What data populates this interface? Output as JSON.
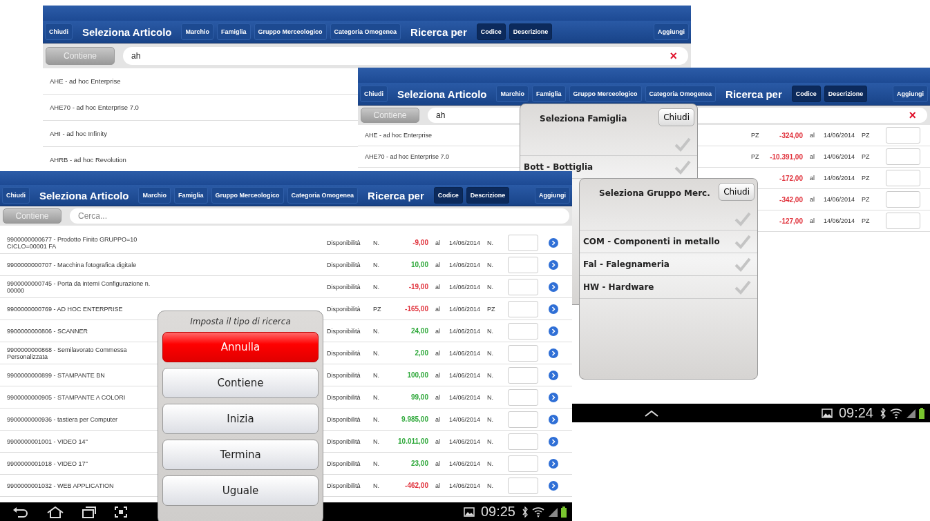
{
  "windows": [
    {
      "toolbar": {
        "close": "Chiudi",
        "title": "Seleziona Articolo",
        "filters": [
          "Marchio",
          "Famiglia",
          "Gruppo Merceologico",
          "Categoria Omogenea"
        ],
        "search_by_label": "Ricerca per",
        "search_by": [
          "Codice",
          "Descrizione"
        ],
        "add": "Aggiungi"
      },
      "search": {
        "mode": "Contiene",
        "value": "ah",
        "clear": "×"
      },
      "rows": [
        {
          "description": "AHE - ad hoc Enterprise"
        },
        {
          "description": "AHE70 - ad hoc Enterprise 7.0"
        },
        {
          "description": "AHI - ad hoc Infinity"
        },
        {
          "description": "AHRB - ad hoc Revolution"
        }
      ]
    },
    {
      "toolbar": {
        "close": "Chiudi",
        "title": "Seleziona Articolo",
        "filters": [
          "Marchio",
          "Famiglia",
          "Gruppo Merceologico",
          "Categoria Omogenea"
        ],
        "search_by_label": "Ricerca per",
        "search_by": [
          "Codice",
          "Descrizione"
        ],
        "add": "Aggiungi"
      },
      "search": {
        "mode": "Contiene",
        "value": "ah",
        "clear": "×"
      },
      "rows": [
        {
          "description": "AHE - ad hoc Enterprise",
          "unit": "PZ",
          "quantity": "-324,00",
          "color": "#e0303a",
          "al": "al",
          "date": "14/06/2014",
          "unit_2": "PZ"
        },
        {
          "description": "AHE70 - ad hoc Enterprise 7.0",
          "unit": "PZ",
          "quantity": "-10.391,00",
          "color": "#e0303a",
          "al": "al",
          "date": "14/06/2014",
          "unit_2": "PZ"
        },
        {
          "quantity": "-172,00",
          "color": "#e0303a",
          "al": "al",
          "date": "14/06/2014",
          "unit_2": "PZ"
        },
        {
          "quantity": "-342,00",
          "color": "#e0303a",
          "al": "al",
          "date": "14/06/2014",
          "unit_2": "PZ"
        },
        {
          "quantity": "-127,00",
          "color": "#e0303a",
          "al": "al",
          "date": "14/06/2014",
          "unit_2": "PZ"
        }
      ],
      "popups": [
        {
          "title": "Seleziona Famiglia",
          "close": "Chiudi",
          "items": [
            {
              "checked": false
            },
            {
              "label": "Bott - Bottiglia",
              "checked": false
            }
          ]
        },
        {
          "title": "Seleziona Gruppo Merc.",
          "close": "Chiudi",
          "items": [
            {
              "checked": false
            },
            {
              "label": "COM - Componenti in metallo",
              "checked": false
            },
            {
              "label": "Fal - Falegnameria",
              "checked": false
            },
            {
              "label": "HW - Hardware",
              "checked": false
            }
          ]
        }
      ],
      "status_bar": {
        "time": "09:24"
      }
    },
    {
      "toolbar": {
        "close": "Chiudi",
        "title": "Seleziona Articolo",
        "filters": [
          "Marchio",
          "Famiglia",
          "Gruppo Merceologico",
          "Categoria Omogenea"
        ],
        "search_by_label": "Ricerca per",
        "search_by": [
          "Codice",
          "Descrizione"
        ],
        "add": "Aggiungi"
      },
      "search": {
        "mode": "Contiene",
        "placeholder": "Cerca..."
      },
      "rows": [
        {
          "description": "9900000000677 - Prodotto Finito GRUPPO=10 CICLO=00001 FA",
          "availability": "Disponibilità",
          "unit": "N.",
          "quantity": "-9,00",
          "color": "#e0303a",
          "al": "al",
          "date": "14/06/2014",
          "unit_2": "N."
        },
        {
          "description": "9900000000707 - Macchina fotografica digitale",
          "availability": "Disponibilità",
          "unit": "N.",
          "quantity": "10,00",
          "color": "#2ea83a",
          "al": "al",
          "date": "14/06/2014",
          "unit_2": "N."
        },
        {
          "description": "9900000000745 - Porta da interni Configurazione n. 00000",
          "availability": "Disponibilità",
          "unit": "N.",
          "quantity": "-19,00",
          "color": "#e0303a",
          "al": "al",
          "date": "14/06/2014",
          "unit_2": "N."
        },
        {
          "description": "9900000000769 - AD HOC ENTERPRISE",
          "availability": "Disponibilità",
          "unit": "PZ",
          "quantity": "-165,00",
          "color": "#e0303a",
          "al": "al",
          "date": "14/06/2014",
          "unit_2": "PZ"
        },
        {
          "description": "9900000000806 - SCANNER",
          "availability": "Disponibilità",
          "unit": "N.",
          "quantity": "24,00",
          "color": "#2ea83a",
          "al": "al",
          "date": "14/06/2014",
          "unit_2": "N."
        },
        {
          "description": "9900000000868 - Semilavorato Commessa Personalizzata",
          "availability": "Disponibilità",
          "unit": "N.",
          "quantity": "2,00",
          "color": "#2ea83a",
          "al": "al",
          "date": "14/06/2014",
          "unit_2": "N."
        },
        {
          "description": "9900000000899 - STAMPANTE BN",
          "availability": "Disponibilità",
          "unit": "N.",
          "quantity": "100,00",
          "color": "#2ea83a",
          "al": "al",
          "date": "14/06/2014",
          "unit_2": "N."
        },
        {
          "description": "9900000000905 - STAMPANTE A COLORI",
          "availability": "Disponibilità",
          "unit": "N.",
          "quantity": "99,00",
          "color": "#2ea83a",
          "al": "al",
          "date": "14/06/2014",
          "unit_2": "N."
        },
        {
          "description": "9900000000936 - tastiera per Computer",
          "availability": "Disponibilità",
          "unit": "N.",
          "quantity": "9.985,00",
          "color": "#2ea83a",
          "al": "al",
          "date": "14/06/2014",
          "unit_2": "N."
        },
        {
          "description": "9900000001001 - VIDEO 14''",
          "availability": "Disponibilità",
          "unit": "N.",
          "quantity": "10.011,00",
          "color": "#2ea83a",
          "al": "al",
          "date": "14/06/2014",
          "unit_2": "N."
        },
        {
          "description": "9900000001018 - VIDEO 17''",
          "availability": "Disponibilità",
          "unit": "N.",
          "quantity": "23,00",
          "color": "#2ea83a",
          "al": "al",
          "date": "14/06/2014",
          "unit_2": "N."
        },
        {
          "description": "9900000001032 - WEB APPLICATION",
          "availability": "Disponibilità",
          "unit": "N.",
          "quantity": "-462,00",
          "color": "#e0303a",
          "al": "al",
          "date": "14/06/2014",
          "unit_2": "N."
        }
      ],
      "dialog": {
        "title": "Imposta il tipo di ricerca",
        "options": [
          {
            "label": "Annulla",
            "kind": "cancel"
          },
          {
            "label": "Contiene",
            "kind": "option"
          },
          {
            "label": "Inizia",
            "kind": "option"
          },
          {
            "label": "Termina",
            "kind": "option"
          },
          {
            "label": "Uguale",
            "kind": "option"
          }
        ]
      },
      "status_bar": {
        "time": "09:25"
      }
    }
  ]
}
